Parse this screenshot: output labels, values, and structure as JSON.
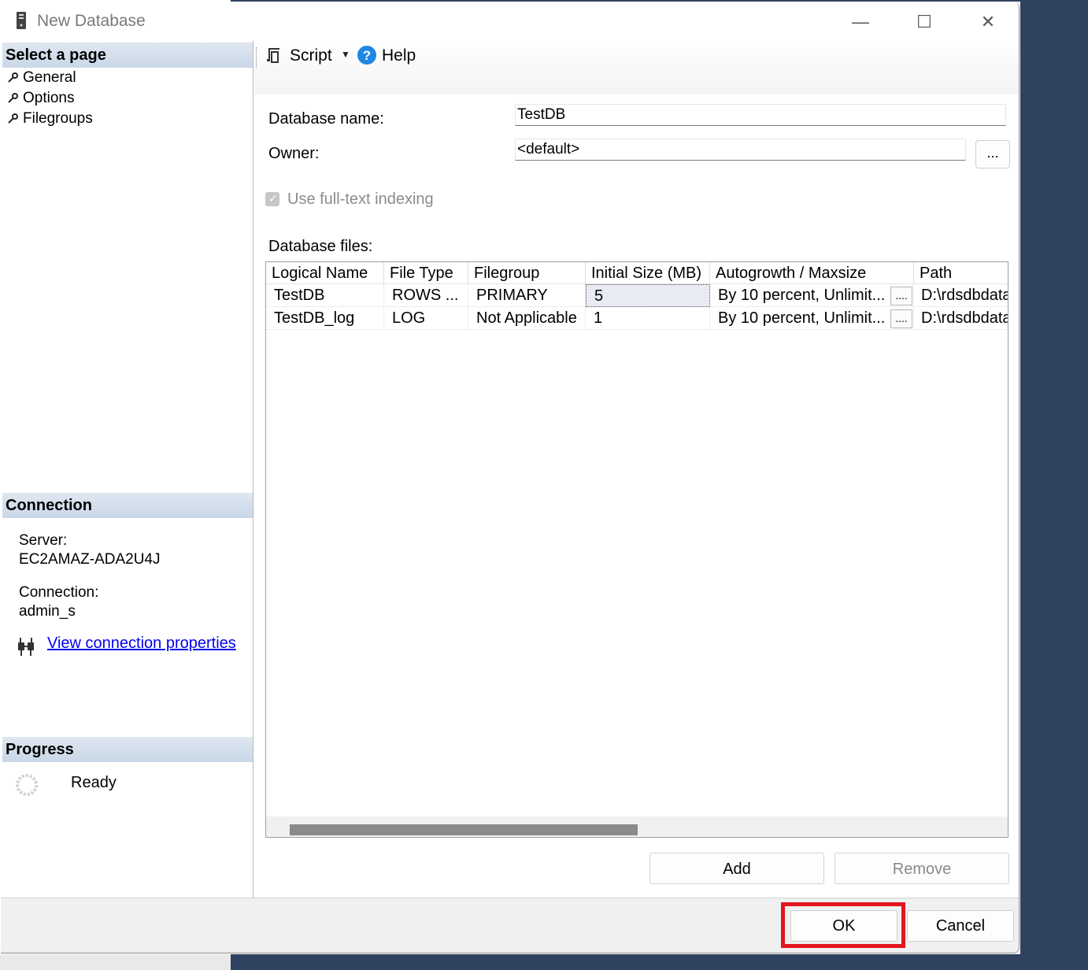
{
  "window": {
    "title": "New Database",
    "minimize_glyph": "—",
    "maximize_glyph": "☐",
    "close_glyph": "✕"
  },
  "left_panel": {
    "select_page_header": "Select a page",
    "pages": [
      {
        "label": "General"
      },
      {
        "label": "Options"
      },
      {
        "label": "Filegroups"
      }
    ],
    "connection_header": "Connection",
    "server_label": "Server:",
    "server_value": "EC2AMAZ-ADA2U4J",
    "connection_label": "Connection:",
    "connection_value": "admin_s",
    "view_connection_link": "View connection properties",
    "progress_header": "Progress",
    "progress_status": "Ready"
  },
  "toolbar": {
    "script_label": "Script",
    "help_label": "Help"
  },
  "general": {
    "database_name_label": "Database name:",
    "database_name_value": "TestDB",
    "owner_label": "Owner:",
    "owner_value": "<default>",
    "owner_browse_label": "...",
    "fulltext_label": "Use full-text indexing",
    "fulltext_checked": true,
    "database_files_label": "Database files:"
  },
  "files_grid": {
    "columns": [
      "Logical Name",
      "File Type",
      "Filegroup",
      "Initial Size (MB)",
      "Autogrowth / Maxsize",
      "Path"
    ],
    "rows": [
      {
        "logical_name": "TestDB",
        "file_type": "ROWS ...",
        "filegroup": "PRIMARY",
        "initial_size": "5",
        "autogrowth": "By 10 percent, Unlimit...",
        "autogrowth_button": "....",
        "path": "D:\\rdsdbdata"
      },
      {
        "logical_name": "TestDB_log",
        "file_type": "LOG",
        "filegroup": "Not Applicable",
        "initial_size": "1",
        "autogrowth": "By 10 percent, Unlimit...",
        "autogrowth_button": "....",
        "path": "D:\\rdsdbdata"
      }
    ]
  },
  "grid_buttons": {
    "add_label": "Add",
    "remove_label": "Remove"
  },
  "dialog_buttons": {
    "ok_label": "OK",
    "cancel_label": "Cancel"
  },
  "colors": {
    "highlight": "#e3161f",
    "link": "#0000ee",
    "section_header": "#c9d7e7",
    "desktop": "#2f4260"
  }
}
